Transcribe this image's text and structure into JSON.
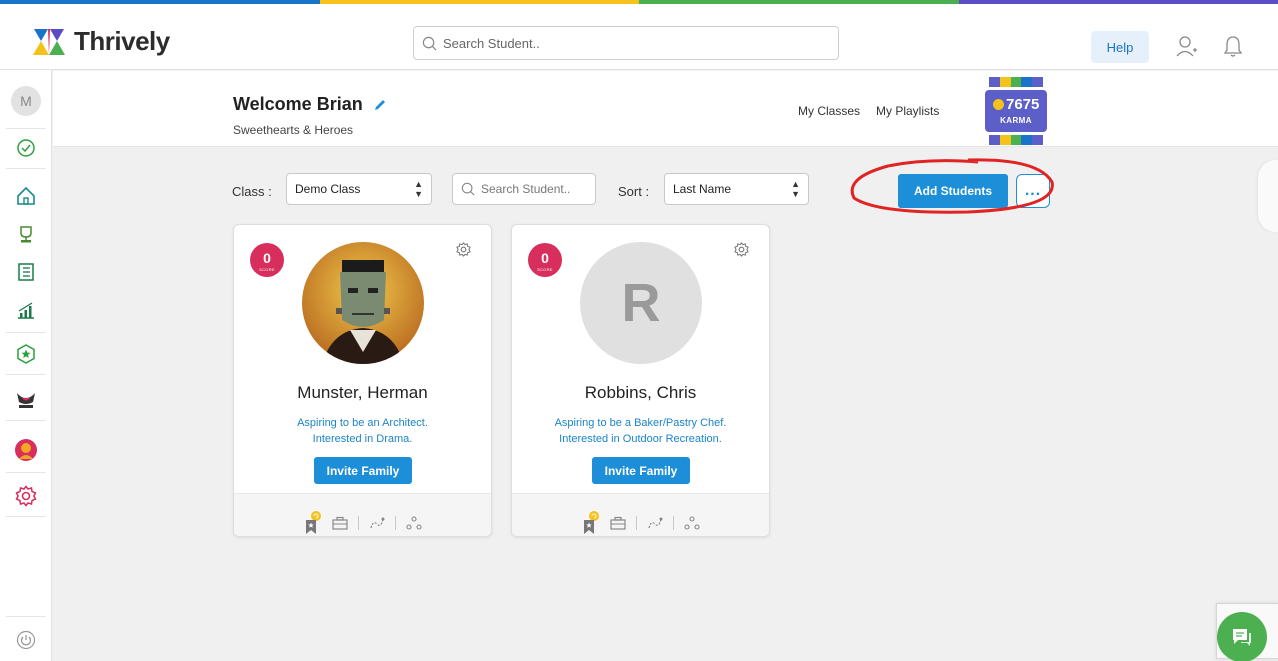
{
  "brand": {
    "name": "Thrively",
    "strip_colors": [
      "#1a73c8",
      "#f5c21b",
      "#4caf50",
      "#5b4cc4"
    ]
  },
  "header": {
    "search_placeholder": "Search Student..",
    "help_label": "Help",
    "icons": [
      "add-user-icon",
      "bell-icon"
    ]
  },
  "sidebar": {
    "avatar_initial": "M",
    "items": [
      {
        "icon": "check-circle-icon"
      },
      {
        "icon": "home-icon"
      },
      {
        "icon": "trophy-icon"
      },
      {
        "icon": "journal-icon"
      },
      {
        "icon": "growth-chart-icon"
      },
      {
        "icon": "star-badge-icon"
      },
      {
        "icon": "heroes-icon"
      },
      {
        "icon": "hero-character-icon"
      },
      {
        "icon": "settings-icon"
      }
    ],
    "bottom_icon": "power-icon"
  },
  "welcome": {
    "title": "Welcome Brian",
    "subtitle": "Sweethearts & Heroes",
    "links": [
      "My Classes",
      "My Playlists"
    ],
    "karma": {
      "value": "7675",
      "label": "KARMA"
    }
  },
  "filters": {
    "class_label": "Class :",
    "class_value": "Demo Class",
    "search_placeholder": "Search Student..",
    "sort_label": "Sort :",
    "sort_value": "Last Name",
    "add_students_label": "Add Students",
    "more_label": "..."
  },
  "students": [
    {
      "name": "Munster, Herman",
      "score": "0",
      "score_label": "SCORE",
      "aspiration": "Aspiring to be an Architect.",
      "interest": "Interested in Drama.",
      "invite_label": "Invite Family",
      "has_photo": true
    },
    {
      "name": "Robbins, Chris",
      "score": "0",
      "score_label": "SCORE",
      "initial": "R",
      "aspiration": "Aspiring to be a Baker/Pastry Chef.",
      "interest": "Interested in Outdoor Recreation.",
      "invite_label": "Invite Family",
      "has_photo": false
    }
  ],
  "colors": {
    "accent": "#1d8fd8",
    "score": "#d72e5d",
    "karma": "#5b5fc7",
    "highlight": "#e02424",
    "chat": "#4caf50"
  }
}
